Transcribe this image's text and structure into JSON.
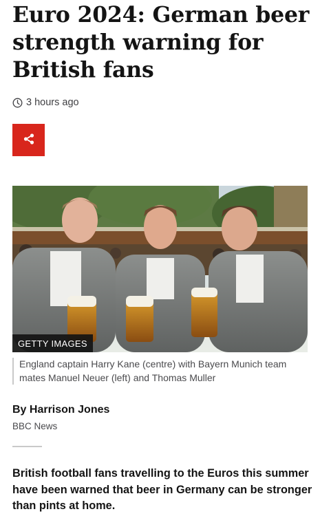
{
  "article": {
    "headline": "Euro 2024: German beer strength warning for British fans",
    "timestamp": "3 hours ago",
    "share_icon": "share-icon",
    "image": {
      "credit": "GETTY IMAGES",
      "caption": "England captain Harry Kane (centre) with Bayern Munich team mates Manuel Neuer (left) and Thomas Muller"
    },
    "author": "By Harrison Jones",
    "publisher": "BBC News",
    "lead_paragraph": "British football fans travelling to the Euros this summer have been warned that beer in Germany can be stronger than pints at home."
  },
  "colors": {
    "brand_red": "#d8261c",
    "text": "#141414",
    "muted": "#4a4a4d"
  }
}
